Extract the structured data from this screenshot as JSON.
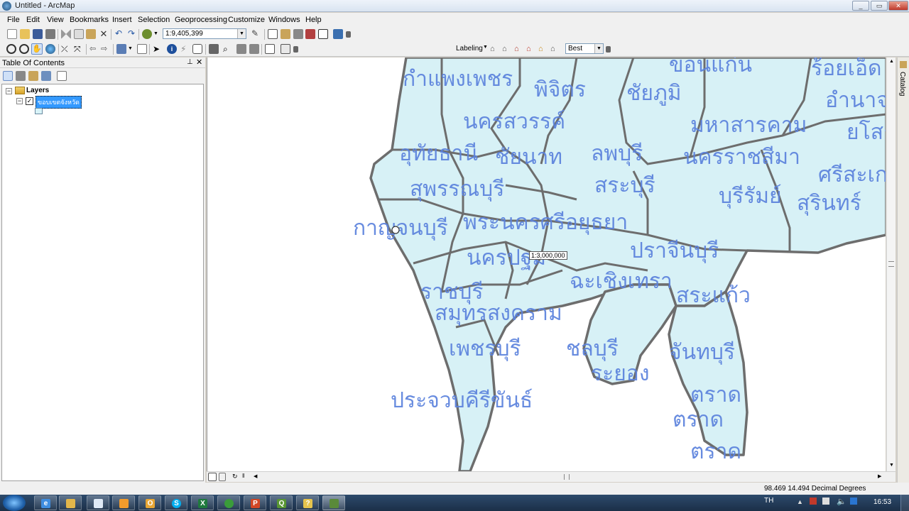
{
  "window": {
    "title": "Untitled - ArcMap"
  },
  "menu": [
    "File",
    "Edit",
    "View",
    "Bookmarks",
    "Insert",
    "Selection",
    "Geoprocessing",
    "Customize",
    "Windows",
    "Help"
  ],
  "toolbar": {
    "scale_value": "1:9,405,399",
    "labeling_label": "Labeling",
    "label_quality": "Best"
  },
  "toc": {
    "title": "Table Of Contents",
    "layers_label": "Layers",
    "layer_name": "ขอบเขตจังหวัด"
  },
  "catalog": {
    "label": "Catalog"
  },
  "map": {
    "scale_tip": "1:3,000,000",
    "labels": [
      "กำแพงเพชร",
      "พิจิตร",
      "ชัยภูมิ",
      "ขอนแก่น",
      "ร้อยเอ็ด",
      "อำนาจ",
      "นครสวรรค์",
      "มหาสารคาม",
      "ยโสธร",
      "อุทัยธานี",
      "ชัยนาท",
      "ลพบุรี",
      "นครราชสีมา",
      "ศรีสะเกษ",
      "สุพรรณบุรี",
      "สระบุรี",
      "บุรีรัมย์",
      "สุรินทร์",
      "กาญจนบุรี",
      "พระนครศรีอยุธยา",
      "นครปฐม",
      "ปราจีนบุรี",
      "ฉะเชิงเทรา",
      "ราชบุรี",
      "สมุทรสงคราม",
      "สระแก้ว",
      "เพชรบุรี",
      "ชลบุรี",
      "จันทบุรี",
      "ระยอง",
      "ประจวบคีรีขันธ์",
      "ตราด",
      "ตราด",
      "ตราด"
    ]
  },
  "status": {
    "coordinates": "98.469  14.494 Decimal Degrees"
  },
  "taskbar": {
    "language": "TH",
    "time": "16:53"
  }
}
